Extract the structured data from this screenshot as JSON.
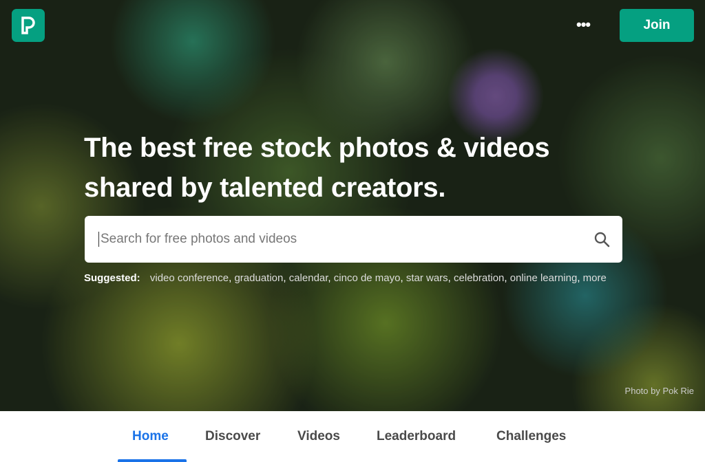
{
  "header": {
    "logo_icon": "pexels-logo-icon",
    "more_icon": "ellipsis-icon",
    "join_label": "Join",
    "brand_color": "#05a081"
  },
  "hero": {
    "title_line1": "The best free stock photos & videos",
    "title_line2": "shared by talented creators.",
    "search": {
      "placeholder": "Search for free photos and videos",
      "value": "",
      "icon": "search-icon"
    },
    "suggested_label": "Suggested:",
    "suggestions": [
      "video conference",
      "graduation",
      "calendar",
      "cinco de mayo",
      "star wars",
      "celebration",
      "online learning",
      "more"
    ],
    "credit": "Photo by Pok Rie"
  },
  "nav": {
    "tabs": [
      {
        "label": "Home",
        "active": true
      },
      {
        "label": "Discover"
      },
      {
        "label": "Videos"
      },
      {
        "label": "Leaderboard"
      },
      {
        "label": "Challenges"
      }
    ],
    "active_color": "#1a73e8"
  }
}
